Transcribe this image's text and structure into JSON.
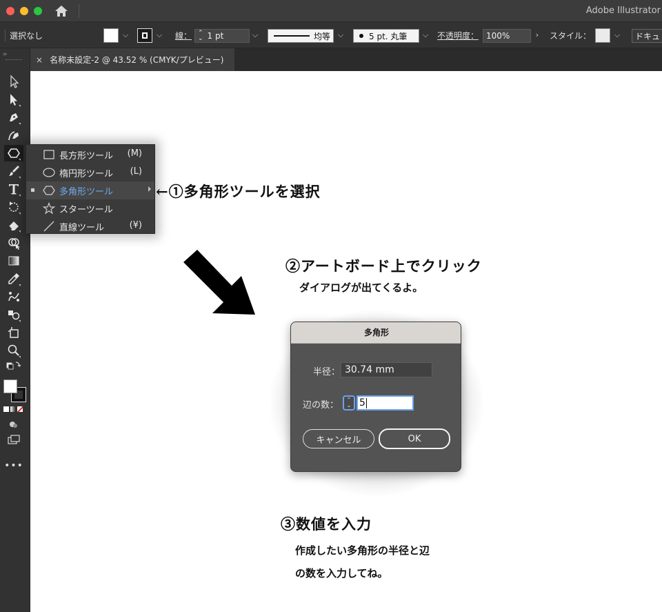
{
  "app": {
    "title": "Adobe Illustrator"
  },
  "controlbar": {
    "selection": "選択なし",
    "stroke_label": "線：",
    "stroke_weight": "1 pt",
    "profile_label": "均等",
    "brush_label": "5 pt. 丸筆",
    "opacity_label": "不透明度：",
    "opacity_value": "100%",
    "style_label": "スタイル：",
    "doc_button": "ドキュ"
  },
  "tab": {
    "close": "×",
    "label": "名称未設定-2 @ 43.52 % (CMYK/プレビュー)"
  },
  "flyout": {
    "items": [
      {
        "label": "長方形ツール",
        "key": "(M)"
      },
      {
        "label": "楕円形ツール",
        "key": "(L)"
      },
      {
        "label": "多角形ツール",
        "key": ""
      },
      {
        "label": "スターツール",
        "key": ""
      },
      {
        "label": "直線ツール",
        "key": "(¥)"
      }
    ]
  },
  "annotations": {
    "step1": "←①多角形ツールを選択",
    "step2": "②アートボード上でクリック",
    "step2_sub": "ダイアログが出てくるよ。",
    "step3": "③数値を入力",
    "step3_sub1": "作成したい多角形の半径と辺",
    "step3_sub2": "の数を入力してね。"
  },
  "dialog": {
    "title": "多角形",
    "radius_label": "半径：",
    "radius_value": "30.74 mm",
    "sides_label": "辺の数：",
    "sides_value": "5",
    "cancel": "キャンセル",
    "ok": "OK"
  },
  "colors": {
    "selected_tool_text": "#6fa9ee",
    "focus_ring": "#6aa2ef"
  }
}
